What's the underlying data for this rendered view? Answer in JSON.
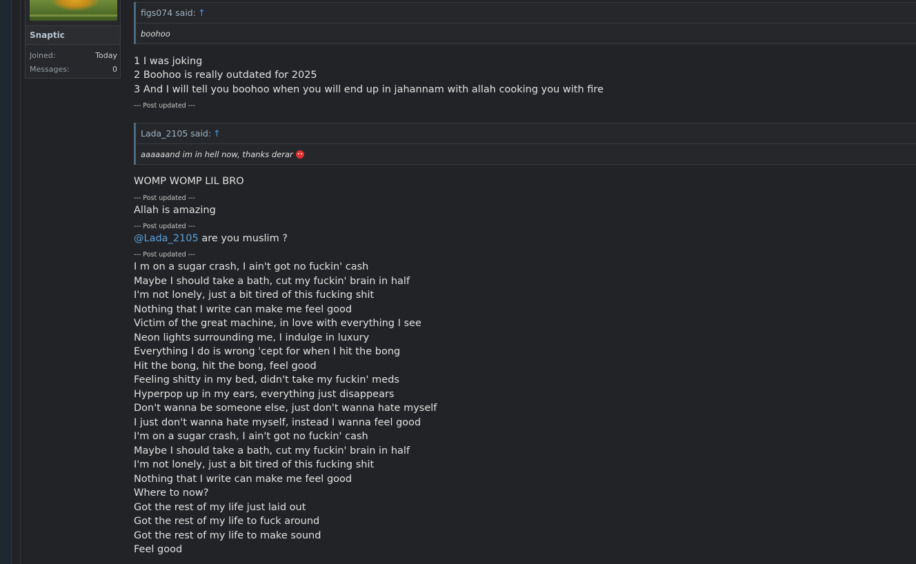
{
  "user": {
    "name": "Snaptic",
    "stats": [
      {
        "key": "Joined:",
        "value": "Today"
      },
      {
        "key": "Messages:",
        "value": "0"
      }
    ]
  },
  "quotes": [
    {
      "author": "figs074 said:",
      "arrow": "↑",
      "text": "boohoo"
    },
    {
      "author": "Lada_2105 said:",
      "arrow": "↑",
      "text": "aaaaaand im in hell now, thanks derar"
    }
  ],
  "post": {
    "reply1": [
      "1 I was joking",
      "2 Boohoo is really outdated for 2025",
      "3 And I will tell you boohoo when you will end up in jahannam with allah cooking you with fire"
    ],
    "separator": "--- Post updated ---",
    "womp": "WOMP WOMP LIL BRO",
    "allah": "Allah is amazing",
    "mention": "@Lada_2105",
    "mention_rest": " are you muslim ?",
    "lyrics": [
      "I m on a sugar crash, I ain't got no fuckin' cash",
      "Maybe I should take a bath, cut my fuckin' brain in half",
      "I'm not lonely, just a bit tired of this fucking shit",
      "Nothing that I write can make me feel good",
      "Victim of the great machine, in love with everything I see",
      "Neon lights surrounding me, I indulge in luxury",
      "Everything I do is wrong 'cept for when I hit the bong",
      "Hit the bong, hit the bong, feel good",
      "Feeling shitty in my bed, didn't take my fuckin' meds",
      "Hyperpop up in my ears, everything just disappears",
      "Don't wanna be someone else, just don't wanna hate myself",
      "I just don't wanna hate myself, instead I wanna feel good",
      "I'm on a sugar crash, I ain't got no fuckin' cash",
      "Maybe I should take a bath, cut my fuckin' brain in half",
      "I'm not lonely, just a bit tired of this fucking shit",
      "Nothing that I write can make me feel good",
      "Where to now?",
      "Got the rest of my life just laid out",
      "Got the rest of my life to fuck around",
      "Got the rest of my life to make sound",
      "Feel good"
    ]
  }
}
